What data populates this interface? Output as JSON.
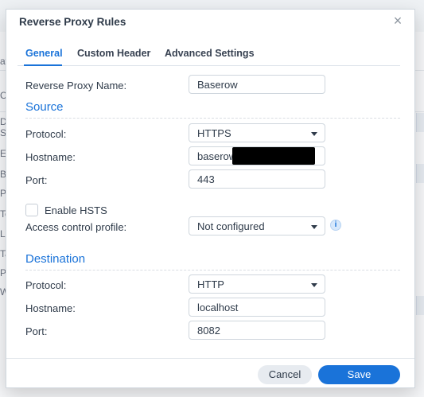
{
  "background": {
    "left_fragments": [
      "av",
      "C",
      "De",
      "Sc",
      "EF",
      "Ba",
      "Pl",
      "Te",
      "Li",
      "Ta",
      "Pe",
      "W"
    ]
  },
  "dialog": {
    "title": "Reverse Proxy Rules",
    "close_label": "×",
    "tabs": [
      {
        "label": "General",
        "active": true
      },
      {
        "label": "Custom Header",
        "active": false
      },
      {
        "label": "Advanced Settings",
        "active": false
      }
    ],
    "reverse_proxy_name": {
      "label": "Reverse Proxy Name:",
      "value": "Baserow"
    },
    "source": {
      "title": "Source",
      "protocol": {
        "label": "Protocol:",
        "value": "HTTPS"
      },
      "hostname": {
        "label": "Hostname:",
        "value": "baserow"
      },
      "port": {
        "label": "Port:",
        "value": "443"
      },
      "enable_hsts": {
        "label": "Enable HSTS",
        "checked": false
      },
      "access_control_profile": {
        "label": "Access control profile:",
        "value": "Not configured"
      },
      "info_glyph": "i"
    },
    "destination": {
      "title": "Destination",
      "protocol": {
        "label": "Protocol:",
        "value": "HTTP"
      },
      "hostname": {
        "label": "Hostname:",
        "value": "localhost"
      },
      "port": {
        "label": "Port:",
        "value": "8082"
      }
    },
    "buttons": {
      "cancel": "Cancel",
      "save": "Save"
    }
  },
  "colors": {
    "accent": "#1a73d9",
    "text": "#2f3b4a",
    "border": "#cfd6dd"
  }
}
